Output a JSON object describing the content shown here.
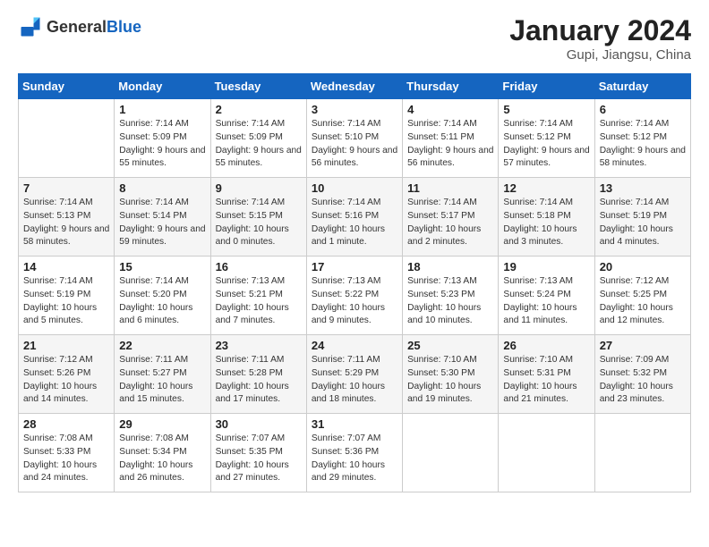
{
  "header": {
    "logo_general": "General",
    "logo_blue": "Blue",
    "month_year": "January 2024",
    "location": "Gupi, Jiangsu, China"
  },
  "days_of_week": [
    "Sunday",
    "Monday",
    "Tuesday",
    "Wednesday",
    "Thursday",
    "Friday",
    "Saturday"
  ],
  "weeks": [
    [
      {
        "day": "",
        "sunrise": "",
        "sunset": "",
        "daylight": ""
      },
      {
        "day": "1",
        "sunrise": "Sunrise: 7:14 AM",
        "sunset": "Sunset: 5:09 PM",
        "daylight": "Daylight: 9 hours and 55 minutes."
      },
      {
        "day": "2",
        "sunrise": "Sunrise: 7:14 AM",
        "sunset": "Sunset: 5:09 PM",
        "daylight": "Daylight: 9 hours and 55 minutes."
      },
      {
        "day": "3",
        "sunrise": "Sunrise: 7:14 AM",
        "sunset": "Sunset: 5:10 PM",
        "daylight": "Daylight: 9 hours and 56 minutes."
      },
      {
        "day": "4",
        "sunrise": "Sunrise: 7:14 AM",
        "sunset": "Sunset: 5:11 PM",
        "daylight": "Daylight: 9 hours and 56 minutes."
      },
      {
        "day": "5",
        "sunrise": "Sunrise: 7:14 AM",
        "sunset": "Sunset: 5:12 PM",
        "daylight": "Daylight: 9 hours and 57 minutes."
      },
      {
        "day": "6",
        "sunrise": "Sunrise: 7:14 AM",
        "sunset": "Sunset: 5:12 PM",
        "daylight": "Daylight: 9 hours and 58 minutes."
      }
    ],
    [
      {
        "day": "7",
        "sunrise": "Sunrise: 7:14 AM",
        "sunset": "Sunset: 5:13 PM",
        "daylight": "Daylight: 9 hours and 58 minutes."
      },
      {
        "day": "8",
        "sunrise": "Sunrise: 7:14 AM",
        "sunset": "Sunset: 5:14 PM",
        "daylight": "Daylight: 9 hours and 59 minutes."
      },
      {
        "day": "9",
        "sunrise": "Sunrise: 7:14 AM",
        "sunset": "Sunset: 5:15 PM",
        "daylight": "Daylight: 10 hours and 0 minutes."
      },
      {
        "day": "10",
        "sunrise": "Sunrise: 7:14 AM",
        "sunset": "Sunset: 5:16 PM",
        "daylight": "Daylight: 10 hours and 1 minute."
      },
      {
        "day": "11",
        "sunrise": "Sunrise: 7:14 AM",
        "sunset": "Sunset: 5:17 PM",
        "daylight": "Daylight: 10 hours and 2 minutes."
      },
      {
        "day": "12",
        "sunrise": "Sunrise: 7:14 AM",
        "sunset": "Sunset: 5:18 PM",
        "daylight": "Daylight: 10 hours and 3 minutes."
      },
      {
        "day": "13",
        "sunrise": "Sunrise: 7:14 AM",
        "sunset": "Sunset: 5:19 PM",
        "daylight": "Daylight: 10 hours and 4 minutes."
      }
    ],
    [
      {
        "day": "14",
        "sunrise": "Sunrise: 7:14 AM",
        "sunset": "Sunset: 5:19 PM",
        "daylight": "Daylight: 10 hours and 5 minutes."
      },
      {
        "day": "15",
        "sunrise": "Sunrise: 7:14 AM",
        "sunset": "Sunset: 5:20 PM",
        "daylight": "Daylight: 10 hours and 6 minutes."
      },
      {
        "day": "16",
        "sunrise": "Sunrise: 7:13 AM",
        "sunset": "Sunset: 5:21 PM",
        "daylight": "Daylight: 10 hours and 7 minutes."
      },
      {
        "day": "17",
        "sunrise": "Sunrise: 7:13 AM",
        "sunset": "Sunset: 5:22 PM",
        "daylight": "Daylight: 10 hours and 9 minutes."
      },
      {
        "day": "18",
        "sunrise": "Sunrise: 7:13 AM",
        "sunset": "Sunset: 5:23 PM",
        "daylight": "Daylight: 10 hours and 10 minutes."
      },
      {
        "day": "19",
        "sunrise": "Sunrise: 7:13 AM",
        "sunset": "Sunset: 5:24 PM",
        "daylight": "Daylight: 10 hours and 11 minutes."
      },
      {
        "day": "20",
        "sunrise": "Sunrise: 7:12 AM",
        "sunset": "Sunset: 5:25 PM",
        "daylight": "Daylight: 10 hours and 12 minutes."
      }
    ],
    [
      {
        "day": "21",
        "sunrise": "Sunrise: 7:12 AM",
        "sunset": "Sunset: 5:26 PM",
        "daylight": "Daylight: 10 hours and 14 minutes."
      },
      {
        "day": "22",
        "sunrise": "Sunrise: 7:11 AM",
        "sunset": "Sunset: 5:27 PM",
        "daylight": "Daylight: 10 hours and 15 minutes."
      },
      {
        "day": "23",
        "sunrise": "Sunrise: 7:11 AM",
        "sunset": "Sunset: 5:28 PM",
        "daylight": "Daylight: 10 hours and 17 minutes."
      },
      {
        "day": "24",
        "sunrise": "Sunrise: 7:11 AM",
        "sunset": "Sunset: 5:29 PM",
        "daylight": "Daylight: 10 hours and 18 minutes."
      },
      {
        "day": "25",
        "sunrise": "Sunrise: 7:10 AM",
        "sunset": "Sunset: 5:30 PM",
        "daylight": "Daylight: 10 hours and 19 minutes."
      },
      {
        "day": "26",
        "sunrise": "Sunrise: 7:10 AM",
        "sunset": "Sunset: 5:31 PM",
        "daylight": "Daylight: 10 hours and 21 minutes."
      },
      {
        "day": "27",
        "sunrise": "Sunrise: 7:09 AM",
        "sunset": "Sunset: 5:32 PM",
        "daylight": "Daylight: 10 hours and 23 minutes."
      }
    ],
    [
      {
        "day": "28",
        "sunrise": "Sunrise: 7:08 AM",
        "sunset": "Sunset: 5:33 PM",
        "daylight": "Daylight: 10 hours and 24 minutes."
      },
      {
        "day": "29",
        "sunrise": "Sunrise: 7:08 AM",
        "sunset": "Sunset: 5:34 PM",
        "daylight": "Daylight: 10 hours and 26 minutes."
      },
      {
        "day": "30",
        "sunrise": "Sunrise: 7:07 AM",
        "sunset": "Sunset: 5:35 PM",
        "daylight": "Daylight: 10 hours and 27 minutes."
      },
      {
        "day": "31",
        "sunrise": "Sunrise: 7:07 AM",
        "sunset": "Sunset: 5:36 PM",
        "daylight": "Daylight: 10 hours and 29 minutes."
      },
      {
        "day": "",
        "sunrise": "",
        "sunset": "",
        "daylight": ""
      },
      {
        "day": "",
        "sunrise": "",
        "sunset": "",
        "daylight": ""
      },
      {
        "day": "",
        "sunrise": "",
        "sunset": "",
        "daylight": ""
      }
    ]
  ]
}
